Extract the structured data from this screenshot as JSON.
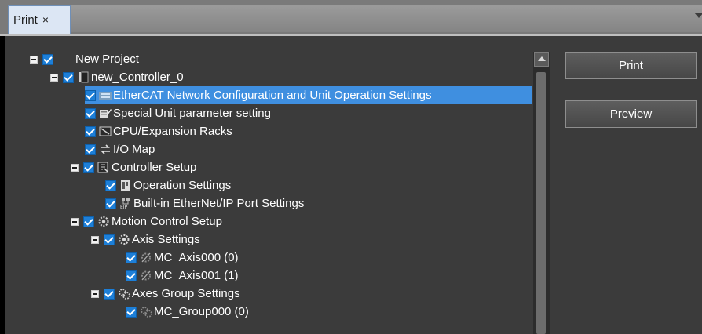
{
  "tab": {
    "title": "Print",
    "close_glyph": "×"
  },
  "tree": {
    "nodes": [
      {
        "id": "new-project",
        "label": "New Project",
        "checked": true,
        "expanded": true,
        "icon": "none"
      },
      {
        "id": "new-controller",
        "label": "new_Controller_0",
        "checked": true,
        "expanded": true,
        "icon": "controller-icon"
      },
      {
        "id": "ethercat",
        "label": "EtherCAT Network Configuration and Unit Operation Settings",
        "checked": true,
        "icon": "ethercat-icon",
        "selected": true
      },
      {
        "id": "special-unit",
        "label": "Special Unit parameter setting",
        "checked": true,
        "icon": "edit-icon"
      },
      {
        "id": "cpu-racks",
        "label": "CPU/Expansion Racks",
        "checked": true,
        "icon": "rack-icon"
      },
      {
        "id": "io-map",
        "label": "I/O Map",
        "checked": true,
        "icon": "io-map-icon"
      },
      {
        "id": "controller-setup",
        "label": "Controller Setup",
        "checked": true,
        "expanded": true,
        "icon": "setup-icon"
      },
      {
        "id": "operation-settings",
        "label": "Operation Settings",
        "checked": true,
        "icon": "operation-icon"
      },
      {
        "id": "ethernet-ip",
        "label": "Built-in EtherNet/IP Port Settings",
        "checked": true,
        "icon": "ethernet-ip-icon"
      },
      {
        "id": "motion-setup",
        "label": "Motion Control Setup",
        "checked": true,
        "expanded": true,
        "icon": "motion-gear-icon"
      },
      {
        "id": "axis-settings",
        "label": "Axis Settings",
        "checked": true,
        "expanded": true,
        "icon": "axis-gear-icon"
      },
      {
        "id": "mc-axis000",
        "label": "MC_Axis000 (0)",
        "checked": true,
        "icon": "axis-item-icon"
      },
      {
        "id": "mc-axis001",
        "label": "MC_Axis001 (1)",
        "checked": true,
        "icon": "axis-item-icon"
      },
      {
        "id": "axes-group",
        "label": "Axes Group Settings",
        "checked": true,
        "expanded": true,
        "icon": "group-gear-icon"
      },
      {
        "id": "mc-group000",
        "label": "MC_Group000 (0)",
        "checked": true,
        "icon": "group-item-icon"
      }
    ]
  },
  "buttons": {
    "print": "Print",
    "preview": "Preview"
  },
  "colors": {
    "selection": "#3f8fe0",
    "checkbox": "#1d7fd8",
    "panel": "#3b3b3b"
  }
}
